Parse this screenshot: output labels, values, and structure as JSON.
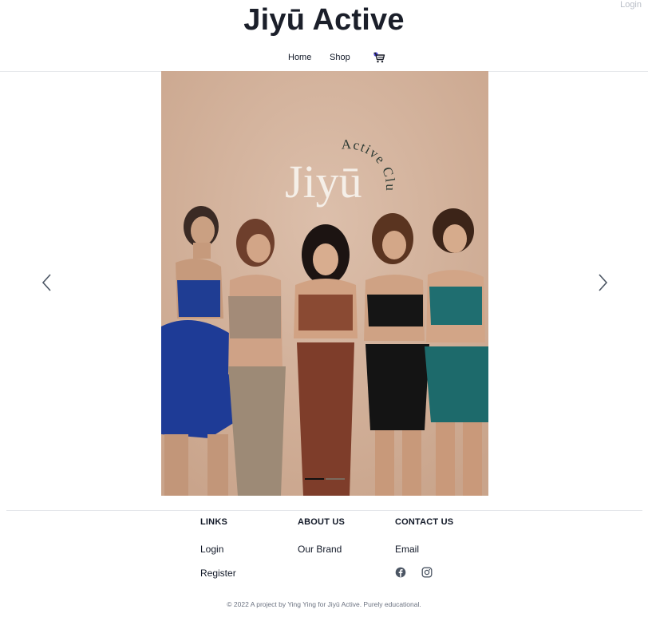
{
  "header": {
    "login_label": "Login",
    "brand_title": "Jiyū Active"
  },
  "nav": {
    "home_label": "Home",
    "shop_label": "Shop",
    "cart_icon": "cart-icon"
  },
  "carousel": {
    "slide_logo_text": "Jiyū",
    "slide_logo_arc_text": "Active Club",
    "prev_icon": "chevron-left-icon",
    "next_icon": "chevron-right-icon",
    "slide_count": 2,
    "active_slide": 1
  },
  "footer": {
    "links": {
      "heading": "LINKS",
      "items": [
        "Login",
        "Register"
      ]
    },
    "about": {
      "heading": "ABOUT US",
      "items": [
        "Our Brand"
      ]
    },
    "contact": {
      "heading": "CONTACT US",
      "items": [
        "Email"
      ],
      "social_icons": [
        "facebook-icon",
        "instagram-icon"
      ]
    },
    "copyright": "© 2022 A project by Ying Ying for Jiyū Active. Purely educational."
  },
  "colors": {
    "accent_cart": "#4f46e5",
    "slide_background": "#d3b19a",
    "text_dark": "#1b1f2a"
  }
}
